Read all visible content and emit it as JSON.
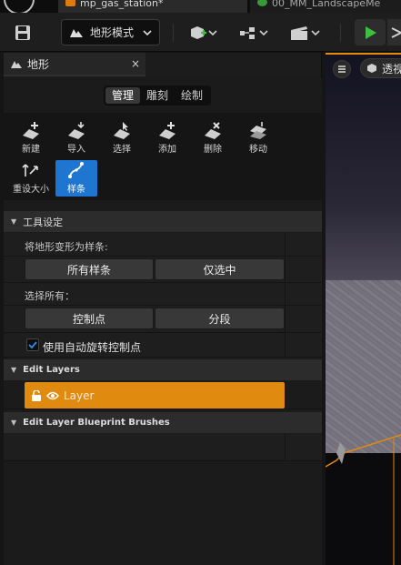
{
  "tabs": {
    "level_tab": "mp_gas_station*",
    "material_tab": "00_MM_LandscapeMe"
  },
  "toolbar": {
    "mode_label": "地形模式",
    "accent_play": "#3fbf3f",
    "accent_add": "#3fbf3f"
  },
  "panel": {
    "title": "地形",
    "close_glyph": "×",
    "modes": [
      "管理",
      "雕刻",
      "绘制"
    ],
    "active_mode": "管理",
    "tools": [
      {
        "label": "新建",
        "icon": "new-landscape-icon"
      },
      {
        "label": "导入",
        "icon": "import-icon"
      },
      {
        "label": "选择",
        "icon": "select-icon"
      },
      {
        "label": "添加",
        "icon": "add-component-icon"
      },
      {
        "label": "删除",
        "icon": "delete-component-icon"
      },
      {
        "label": "移动",
        "icon": "move-icon"
      },
      {
        "label": "重设大小",
        "icon": "resize-icon"
      },
      {
        "label": "样条",
        "icon": "spline-icon"
      }
    ],
    "active_tool": "样条",
    "tool_settings": {
      "header": "工具设定",
      "deform_label": "将地形变形为样条:",
      "all_splines_btn": "所有样条",
      "selected_only_btn": "仅选中",
      "select_all_label": "选择所有：",
      "control_points_btn": "控制点",
      "segments_btn": "分段",
      "auto_rotate_label": "使用自动旋转控制点",
      "auto_rotate_checked": true
    },
    "edit_layers": {
      "header": "Edit Layers",
      "layer_name": "Layer",
      "layer_color": "#e18a10"
    },
    "blueprint_brushes": {
      "header": "Edit Layer Blueprint Brushes"
    }
  },
  "viewport": {
    "view_mode": "透视"
  }
}
